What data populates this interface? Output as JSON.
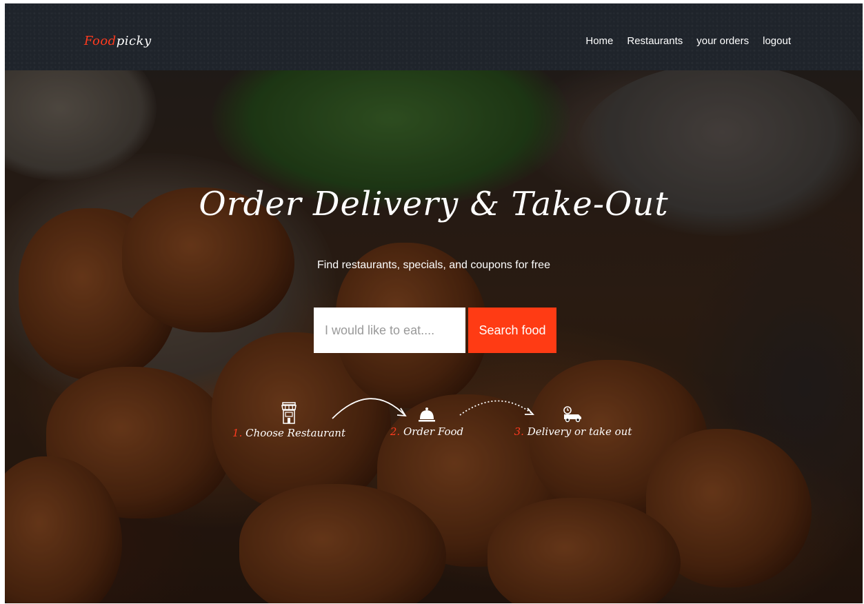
{
  "brand": {
    "part1": "Food",
    "part2": "picky"
  },
  "nav": {
    "items": [
      {
        "label": "Home"
      },
      {
        "label": "Restaurants"
      },
      {
        "label": "your orders"
      },
      {
        "label": "logout"
      }
    ]
  },
  "hero": {
    "title": "Order Delivery & Take-Out",
    "subtitle": "Find restaurants, specials, and coupons for free",
    "search": {
      "placeholder": "I would like to eat....",
      "value": "",
      "button_label": "Search food"
    }
  },
  "steps": [
    {
      "number": "1.",
      "label": "Choose Restaurant",
      "icon": "store-icon"
    },
    {
      "number": "2.",
      "label": "Order Food",
      "icon": "cloche-icon"
    },
    {
      "number": "3.",
      "label": "Delivery or take out",
      "icon": "delivery-truck-icon"
    }
  ],
  "colors": {
    "accent": "#ff3b14",
    "navbar_bg": "#1f242b",
    "text": "#ffffff"
  }
}
